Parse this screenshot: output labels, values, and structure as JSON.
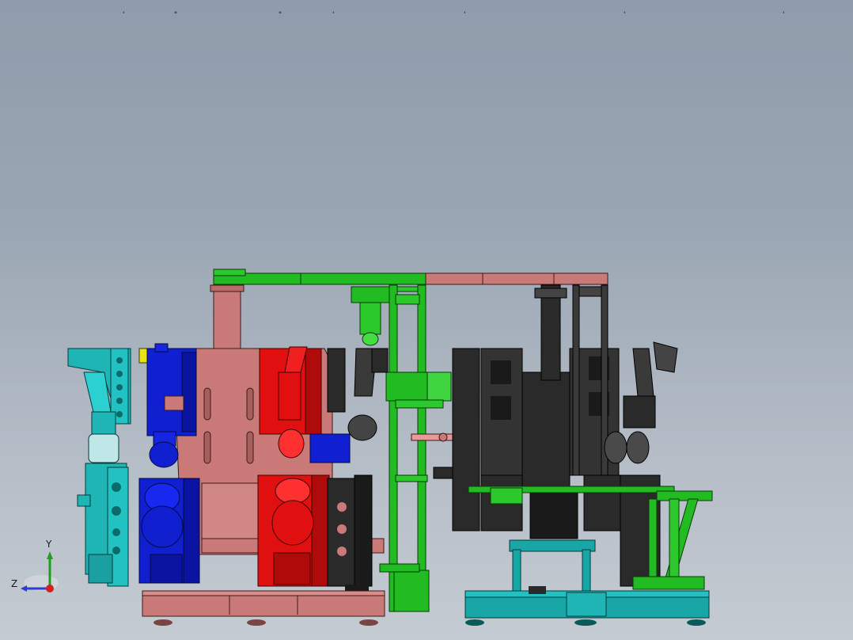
{
  "viewport": {
    "background_top": "#8e9cab",
    "background_bottom": "#c4cbd2"
  },
  "top_markers": [
    "'",
    "\"",
    "\"",
    "'",
    "'",
    "'",
    "'"
  ],
  "triad": {
    "x_axis_label": "",
    "y_axis_label": "Y",
    "z_axis_label": "Z",
    "y_color": "#1f9e1f",
    "z_color": "#2a3fd6",
    "x_color": "#d61e1e"
  },
  "parts": {
    "frame_pink": "#c97a78",
    "frame_green": "#22bb22",
    "module_blue": "#1020d0",
    "module_red": "#e01010",
    "module_cyan": "#1fb5b5",
    "module_black": "#2a2a2a",
    "base_teal": "#18a6a6",
    "accent_yellow": "#e8e21a"
  }
}
